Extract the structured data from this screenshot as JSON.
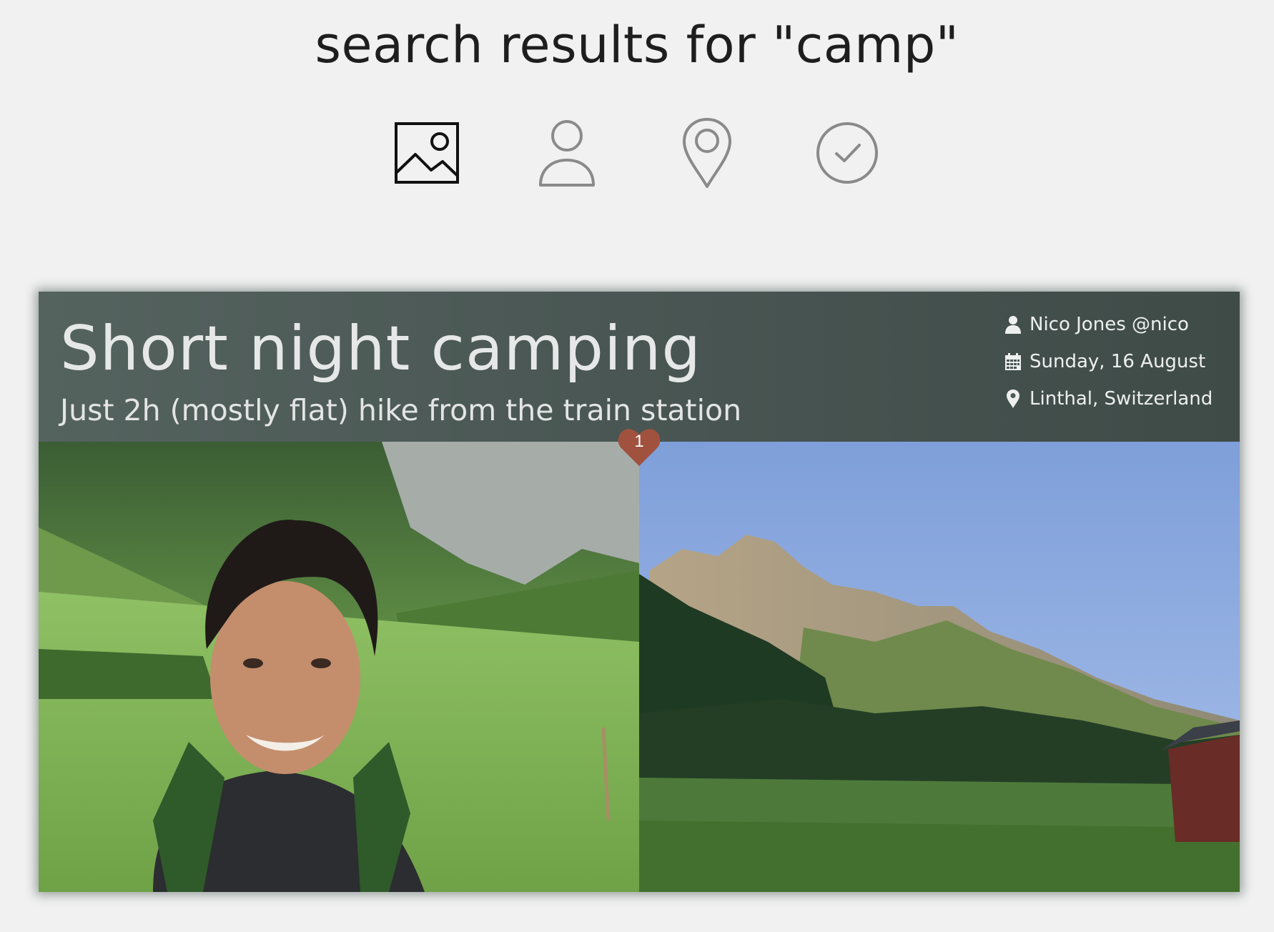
{
  "search": {
    "title": "search results for \"camp\""
  },
  "tabs": [
    {
      "icon": "image-icon",
      "active": true
    },
    {
      "icon": "user-icon",
      "active": false
    },
    {
      "icon": "location-pin-icon",
      "active": false
    },
    {
      "icon": "check-circle-icon",
      "active": false
    }
  ],
  "result": {
    "title": "Short night camping",
    "subtitle": "Just 2h (mostly flat) hike from the train station",
    "author": "Nico Jones @nico",
    "date": "Sunday, 16 August",
    "location": "Linthal, Switzerland",
    "likes": "1",
    "photos": [
      "selfie-in-meadow-photo",
      "mountain-meadow-photo"
    ]
  },
  "colors": {
    "background": "#f1f1f1",
    "header": "#4a5754",
    "like": "#a0523f",
    "active_tab": "#111111",
    "inactive_tab": "#8a8a8a"
  }
}
